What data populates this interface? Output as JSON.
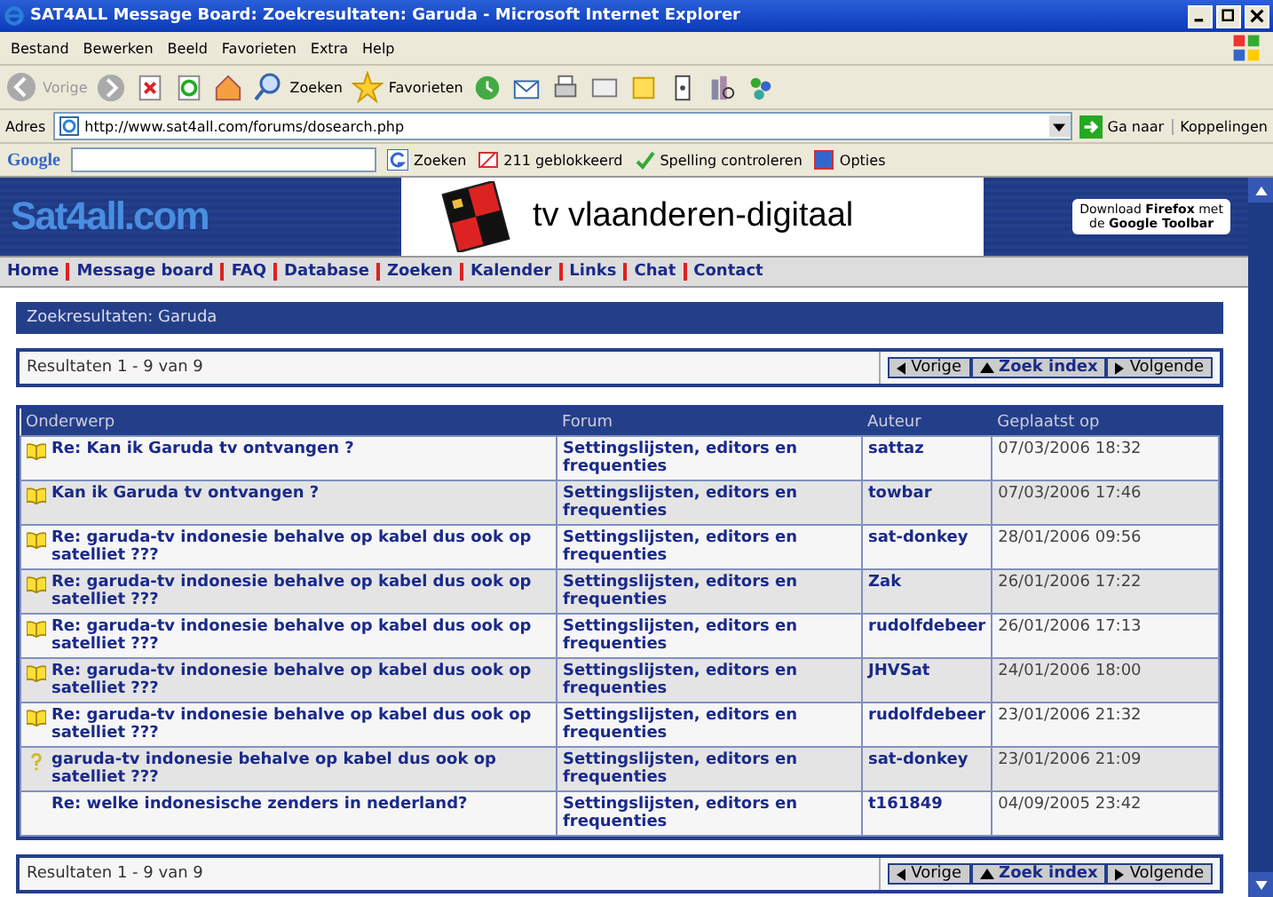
{
  "window": {
    "title": "SAT4ALL Message Board: Zoekresultaten: Garuda - Microsoft Internet Explorer"
  },
  "menu": [
    "Bestand",
    "Bewerken",
    "Beeld",
    "Favorieten",
    "Extra",
    "Help"
  ],
  "toolbar": {
    "back": "Vorige",
    "search": "Zoeken",
    "favorites": "Favorieten"
  },
  "address": {
    "label": "Adres",
    "url": "http://www.sat4all.com/forums/dosearch.php",
    "go": "Ga naar",
    "links": "Koppelingen"
  },
  "google_bar": {
    "logo": "Google",
    "search": "Zoeken",
    "blocked": "211 geblokkeerd",
    "spelling": "Spelling controleren",
    "options": "Opties"
  },
  "banner": {
    "logo": "Sat4all.com",
    "ad": "tv vlaanderen-digitaal",
    "firefox_line1": "Download **Firefox** met",
    "firefox_line2": "de **Google Toolbar**"
  },
  "nav": [
    "Home",
    "Message board",
    "FAQ",
    "Database",
    "Zoeken",
    "Kalender",
    "Links",
    "Chat",
    "Contact"
  ],
  "page_title": "Zoekresultaten: Garuda",
  "pager_top": {
    "summary": "Resultaten 1 - 9 van 9",
    "prev": "Vorige",
    "index": "Zoek index",
    "next": "Volgende"
  },
  "table": {
    "columns": [
      "Onderwerp",
      "Forum",
      "Auteur",
      "Geplaatst op"
    ],
    "rows": [
      {
        "kind": "book",
        "subject": "Re: Kan ik Garuda tv ontvangen ?",
        "forum": "Settingslijsten, editors en frequenties",
        "author": "sattaz",
        "date": "07/03/2006 18:32"
      },
      {
        "kind": "book",
        "subject": "Kan ik Garuda tv ontvangen ?",
        "forum": "Settingslijsten, editors en frequenties",
        "author": "towbar",
        "date": "07/03/2006 17:46"
      },
      {
        "kind": "book",
        "subject": "Re: garuda-tv indonesie behalve op kabel dus ook op satelliet ???",
        "forum": "Settingslijsten, editors en frequenties",
        "author": "sat-donkey",
        "date": "28/01/2006 09:56"
      },
      {
        "kind": "book",
        "subject": "Re: garuda-tv indonesie behalve op kabel dus ook op satelliet ???",
        "forum": "Settingslijsten, editors en frequenties",
        "author": "Zak",
        "date": "26/01/2006 17:22"
      },
      {
        "kind": "book",
        "subject": "Re: garuda-tv indonesie behalve op kabel dus ook op satelliet ???",
        "forum": "Settingslijsten, editors en frequenties",
        "author": "rudolfdebeer",
        "date": "26/01/2006 17:13"
      },
      {
        "kind": "book",
        "subject": "Re: garuda-tv indonesie behalve op kabel dus ook op satelliet ???",
        "forum": "Settingslijsten, editors en frequenties",
        "author": "JHVSat",
        "date": "24/01/2006 18:00"
      },
      {
        "kind": "book",
        "subject": "Re: garuda-tv indonesie behalve op kabel dus ook op satelliet ???",
        "forum": "Settingslijsten, editors en frequenties",
        "author": "rudolfdebeer",
        "date": "23/01/2006 21:32"
      },
      {
        "kind": "question",
        "subject": "garuda-tv indonesie behalve op kabel dus ook op satelliet ???",
        "forum": "Settingslijsten, editors en frequenties",
        "author": "sat-donkey",
        "date": "23/01/2006 21:09"
      },
      {
        "kind": "none",
        "subject": "Re: welke indonesische zenders in nederland?",
        "forum": "Settingslijsten, editors en frequenties",
        "author": "t161849",
        "date": "04/09/2005 23:42"
      }
    ]
  },
  "pager_bottom": {
    "summary": "Resultaten 1 - 9 van 9",
    "prev": "Vorige",
    "index": "Zoek index",
    "next": "Volgende"
  }
}
